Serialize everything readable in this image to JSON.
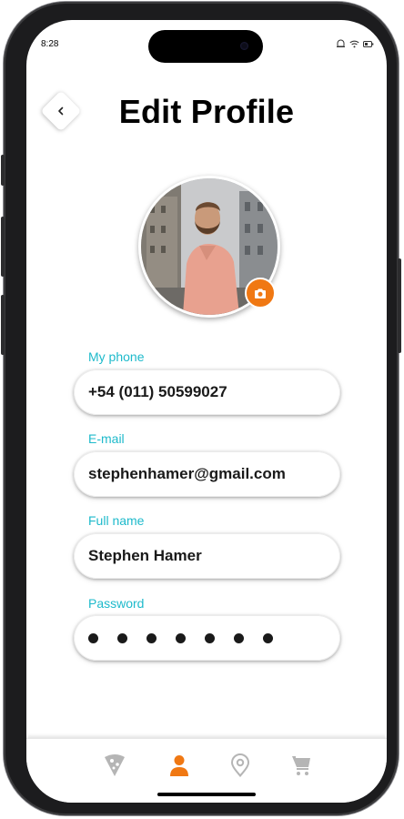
{
  "status_bar": {
    "time": "8:28"
  },
  "header": {
    "title": "Edit Profile",
    "back_icon": "chevron-left-icon"
  },
  "profile": {
    "avatar_icon": "profile-photo",
    "camera_icon": "camera-icon",
    "accent_color": "#F07813"
  },
  "form": {
    "phone": {
      "label": "My phone",
      "value": "+54 (011) 50599027"
    },
    "email": {
      "label": "E-mail",
      "value": "stephenhamer@gmail.com"
    },
    "name": {
      "label": "Full name",
      "value": "Stephen Hamer"
    },
    "password": {
      "label": "Password",
      "masked_length": 7
    },
    "label_color": "#1EBACB"
  },
  "tab_bar": {
    "items": [
      {
        "icon": "pizza-icon",
        "active": false
      },
      {
        "icon": "person-icon",
        "active": true
      },
      {
        "icon": "location-pin-icon",
        "active": false
      },
      {
        "icon": "cart-icon",
        "active": false
      }
    ],
    "active_color": "#F07813",
    "inactive_color": "#B5B5B5"
  }
}
